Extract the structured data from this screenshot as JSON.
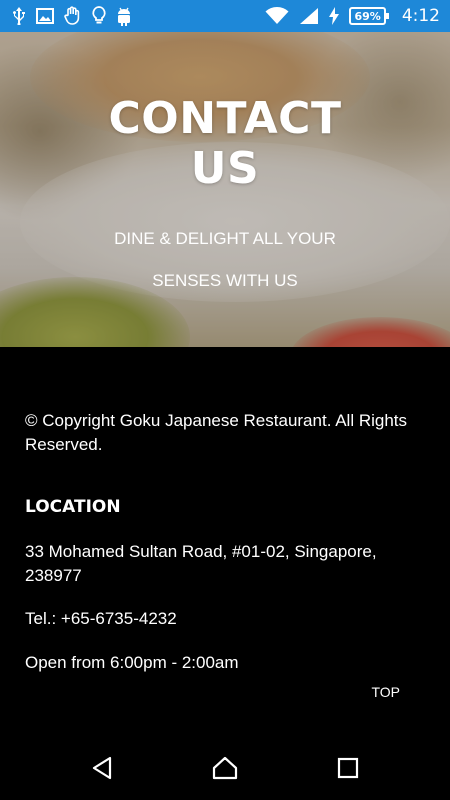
{
  "status_bar": {
    "battery": "69%",
    "time": "4:12",
    "left_icons": [
      "usb-icon",
      "image-icon",
      "hand-icon",
      "bulb-icon",
      "android-icon"
    ],
    "right_icons": [
      "wifi-icon",
      "signal-icon",
      "charging-icon",
      "battery-icon"
    ],
    "color": "#1e88d8"
  },
  "hero": {
    "title_line1": "CONTACT",
    "title_line2": "US",
    "subtitle_line1": "DINE & DELIGHT ALL YOUR",
    "subtitle_line2": "SENSES WITH US"
  },
  "footer": {
    "copyright": "© Copyright Goku Japanese Restaurant. All Rights Reserved.",
    "location_title": "LOCATION",
    "address": "33 Mohamed Sultan Road, #01-02, Singapore, 238977",
    "phone": "Tel.: +65-6735-4232",
    "hours": "Open from 6:00pm - 2:00am",
    "top_link": "TOP"
  },
  "nav_bar": {
    "buttons": [
      "back-icon",
      "home-icon",
      "recents-icon"
    ]
  }
}
